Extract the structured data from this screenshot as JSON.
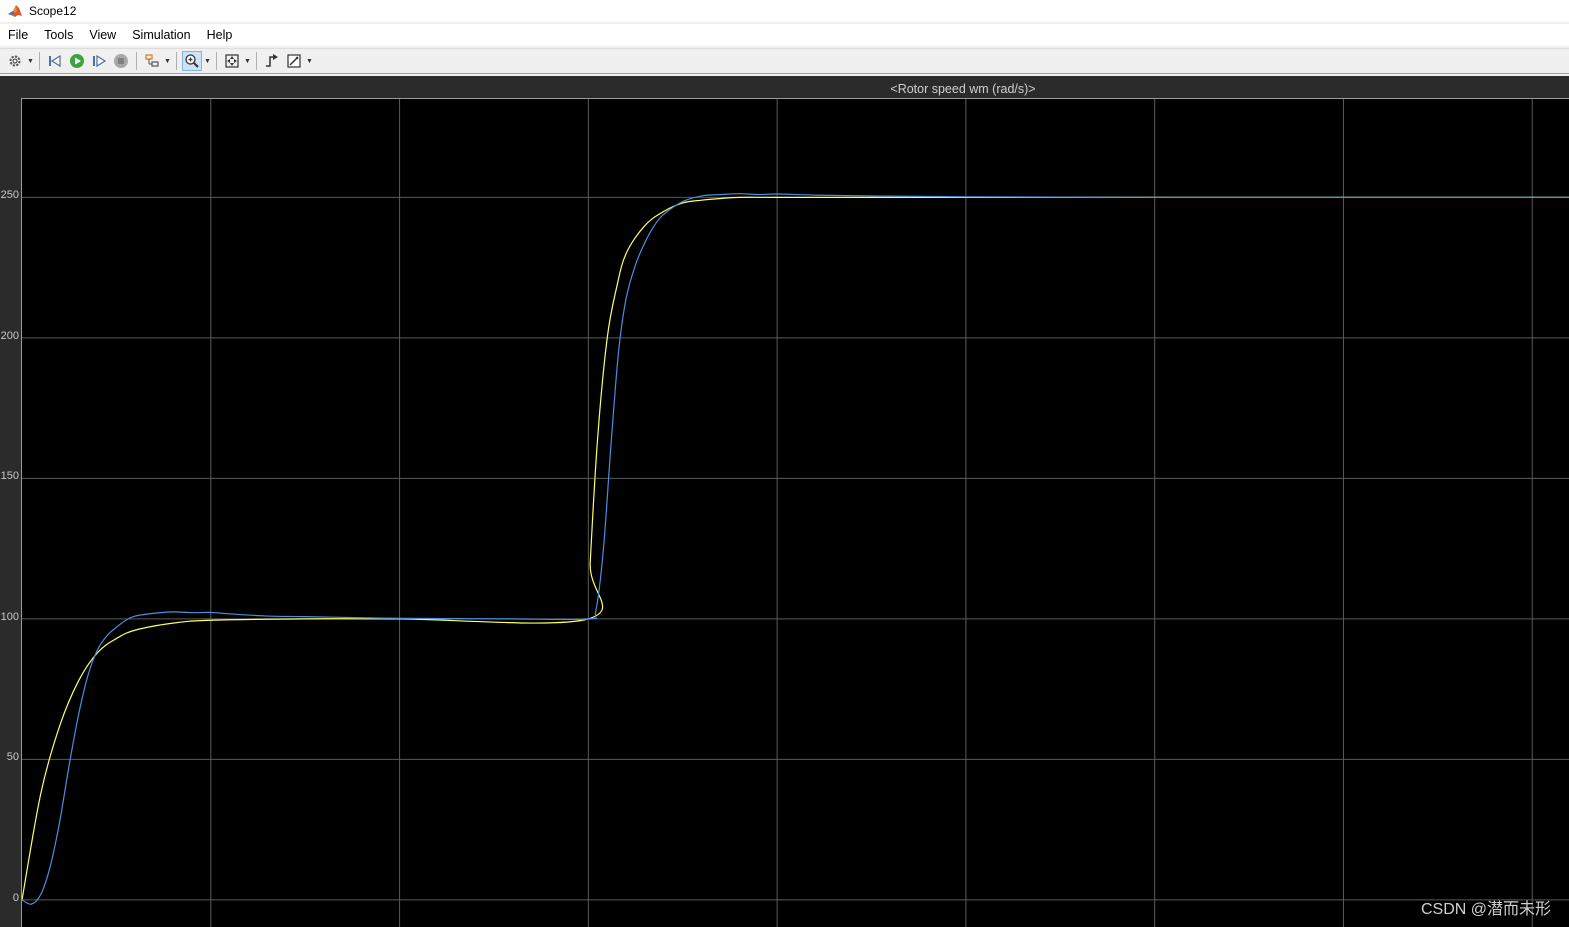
{
  "window": {
    "title": "Scope12"
  },
  "menu": [
    "File",
    "Tools",
    "View",
    "Simulation",
    "Help"
  ],
  "toolbar": {
    "buttons": [
      {
        "name": "settings-icon",
        "dropdown": true
      },
      {
        "name": "step-back-icon"
      },
      {
        "name": "run-icon"
      },
      {
        "name": "step-forward-icon"
      },
      {
        "name": "stop-icon"
      },
      {
        "name": "highlight-signals-icon",
        "dropdown": true
      },
      {
        "name": "zoom-in-icon",
        "dropdown": true,
        "active": true
      },
      {
        "name": "autoscale-icon",
        "dropdown": true
      },
      {
        "name": "trigger-icon"
      },
      {
        "name": "measure-icon",
        "dropdown": true
      }
    ]
  },
  "scope": {
    "plot_title": "<Rotor speed wm (rad/s)>",
    "watermark": "CSDN @潜而未形"
  },
  "chart_data": {
    "type": "line",
    "title": "<Rotor speed wm (rad/s)>",
    "xlabel": "",
    "ylabel": "",
    "xlim": [
      0,
      8.2
    ],
    "ylim": [
      -10,
      285
    ],
    "yticks": [
      0,
      50,
      100,
      150,
      200,
      250
    ],
    "xgrid": [
      1,
      2,
      3,
      4,
      5,
      6,
      7,
      8
    ],
    "grid": true,
    "background": "#000000",
    "grid_color": "#5a5a5a",
    "series": [
      {
        "color": "#ffff66",
        "x": [
          0,
          0.1,
          0.2,
          0.3,
          0.4,
          0.5,
          0.6,
          0.8,
          1.0,
          1.5,
          2.0,
          3.0,
          3.01,
          3.05,
          3.1,
          3.15,
          3.2,
          3.3,
          3.4,
          3.5,
          3.6,
          3.7,
          3.8,
          4.0,
          4.5,
          5.0,
          6.0,
          7.0,
          8.2
        ],
        "values": [
          0,
          38,
          62,
          78,
          88,
          93,
          96,
          98.5,
          99.5,
          100,
          100,
          100,
          120,
          165,
          200,
          218,
          230,
          240,
          245,
          248,
          249,
          249.6,
          250,
          250,
          250,
          250,
          250,
          250,
          250
        ]
      },
      {
        "color": "#4a8fe0",
        "x": [
          0,
          0.05,
          0.1,
          0.15,
          0.2,
          0.25,
          0.3,
          0.35,
          0.4,
          0.45,
          0.5,
          0.55,
          0.6,
          0.7,
          0.8,
          0.9,
          1.0,
          1.1,
          1.3,
          1.5,
          1.8,
          2.0,
          2.3,
          2.6,
          3.0,
          3.04,
          3.08,
          3.12,
          3.16,
          3.2,
          3.25,
          3.3,
          3.35,
          3.4,
          3.5,
          3.6,
          3.7,
          3.8,
          3.9,
          4.0,
          4.2,
          4.5,
          5.0,
          6.0,
          7.0,
          8.2
        ],
        "values": [
          0,
          -1.5,
          2,
          12,
          28,
          48,
          66,
          80,
          89,
          94,
          97,
          99.5,
          101,
          102,
          102.5,
          102.2,
          102.3,
          101.8,
          101,
          100.8,
          100.4,
          100.2,
          100.1,
          100,
          100,
          103,
          125,
          162,
          195,
          214,
          226,
          234,
          240,
          244,
          248.5,
          250.5,
          251,
          251.3,
          251,
          251.2,
          250.8,
          250.5,
          250.2,
          250,
          250,
          250
        ]
      }
    ]
  }
}
